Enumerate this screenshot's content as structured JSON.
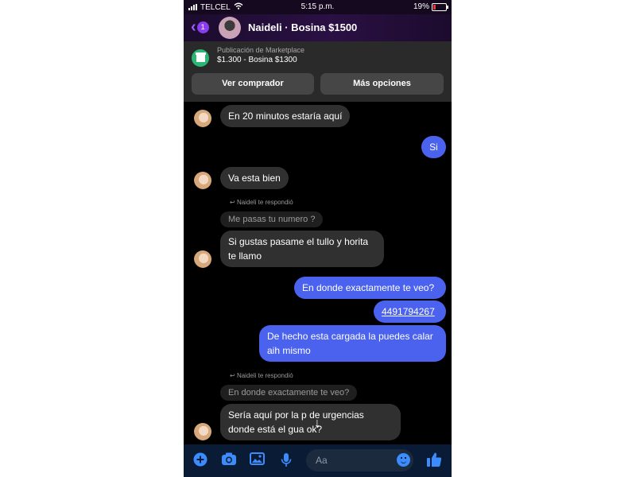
{
  "status": {
    "carrier": "TELCEL",
    "time": "5:15 p.m.",
    "battery": "19%"
  },
  "header": {
    "badge_count": "1",
    "title": "Naideli · Bosina $1500"
  },
  "marketplace": {
    "label": "Publicación de Marketplace",
    "item": "$1.300 - Bosina $1300",
    "btn_buyer": "Ver comprador",
    "btn_more": "Más opciones"
  },
  "messages": [
    {
      "from": "them",
      "text": "En 20 minutos estaría aquí"
    },
    {
      "from": "me",
      "text": "Si"
    },
    {
      "from": "them",
      "text": "Va esta bien"
    },
    {
      "from": "them",
      "replied_label": "Naideli te respondió",
      "quoted": "Me pasas tu numero ?",
      "text": "Si gustas pasame el tullo y horita te llamo"
    },
    {
      "from": "me",
      "text": "En donde exactamente te veo?"
    },
    {
      "from": "me",
      "text": "4491794267"
    },
    {
      "from": "me",
      "text": "De hecho esta cargada la puedes calar aih mismo"
    },
    {
      "from": "them",
      "replied_label": "Naideli te respondió",
      "quoted": "En donde exactamente te veo?",
      "text": "Sería aquí por la p      de urgencias donde está el gua      ok?"
    }
  ],
  "composer": {
    "placeholder": "Aa"
  },
  "colors": {
    "accent_purple": "#8a3cf0",
    "outgoing_bubble": "#4a62ee",
    "incoming_bubble": "#303030",
    "composer_icon": "#3b8cff"
  },
  "icons": [
    "back-chevron-icon",
    "store-icon",
    "reply-arrow-icon",
    "arrow-down-icon",
    "plus-icon",
    "camera-icon",
    "image-icon",
    "mic-icon",
    "emoji-icon",
    "thumbs-up-icon"
  ]
}
